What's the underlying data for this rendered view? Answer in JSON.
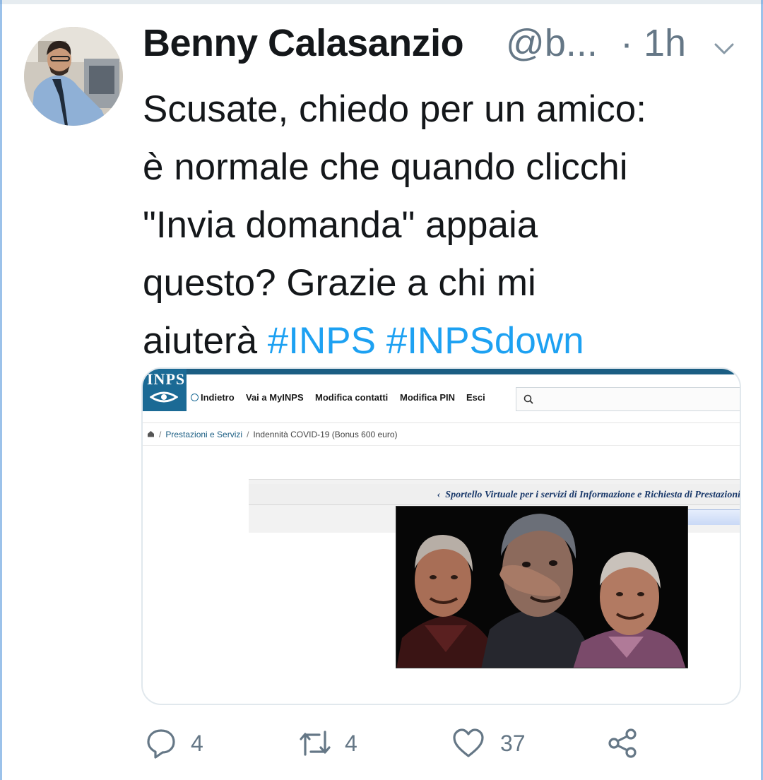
{
  "tweet": {
    "author_name": "Benny Calasanzio",
    "author_handle": "@b...",
    "separator": "·",
    "time": "1h",
    "text_lines": [
      "Scusate, chiedo per un amico:",
      "è normale che quando clicchi",
      "\"Invia domanda\" appaia",
      "questo? Grazie a chi mi",
      "aiuterà"
    ],
    "hashtags": [
      "#INPS",
      "#INPSdown"
    ],
    "hashtag_color": "#1da1f2"
  },
  "screenshot": {
    "logo_text": "INPS",
    "nav": [
      "Indietro",
      "Vai a MyINPS",
      "Modifica contatti",
      "Modifica PIN",
      "Esci"
    ],
    "breadcrumb": [
      "Prestazioni e Servizi",
      "Indennità COVID-19 (Bonus 600 euro)"
    ],
    "panel_title": "Sportello Virtuale per i servizi di Informazione e Richiesta di Prestazioni"
  },
  "actions": {
    "reply_count": "4",
    "retweet_count": "4",
    "like_count": "37"
  },
  "icons": {
    "avatar": "avatar",
    "caret": "chevron-down-icon",
    "reply": "reply-icon",
    "retweet": "retweet-icon",
    "like": "heart-icon",
    "share": "share-icon",
    "search": "search-icon",
    "home": "home-icon"
  }
}
